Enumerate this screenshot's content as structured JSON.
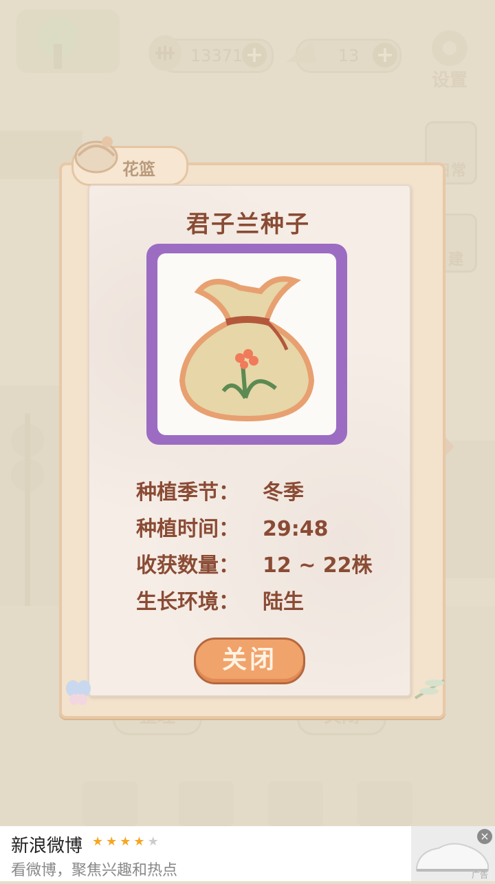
{
  "hud": {
    "fish_count": "13371",
    "cheese_count": "13",
    "settings_label": "设置",
    "plus": "+"
  },
  "side_buttons": [
    "日常",
    "建"
  ],
  "panel": {
    "tab_label": "花篮",
    "item_title": "君子兰种子",
    "info": [
      {
        "label": "种植季节：",
        "value": "冬季"
      },
      {
        "label": "种植时间：",
        "value": "29:48"
      },
      {
        "label": "收获数量：",
        "value": "12 ~ 22株"
      },
      {
        "label": "生长环境：",
        "value": "陆生"
      }
    ],
    "close_label": "关闭"
  },
  "under_buttons": {
    "organize_label": "整理",
    "close_label": "关闭"
  },
  "ad": {
    "title": "新浪微博",
    "subtitle": "看微博，聚焦兴趣和热点",
    "rating": 4,
    "rating_max": 5,
    "tag": "广告",
    "close_symbol": "×"
  },
  "colors": {
    "frame": "#9c6cc2",
    "title_text": "#8a4b34",
    "close_button": "#f0a36b",
    "star": "#f5a623"
  }
}
